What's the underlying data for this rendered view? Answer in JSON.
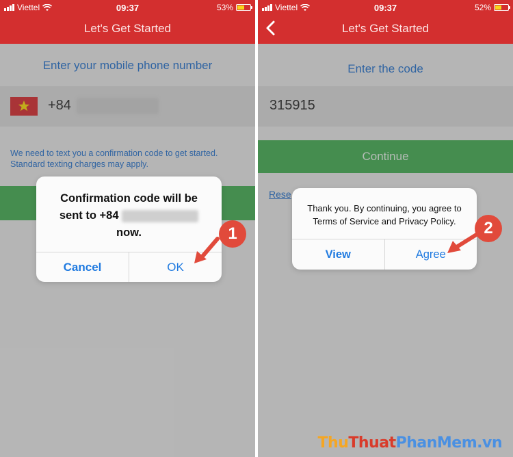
{
  "colors": {
    "topbar": "#d32f2f",
    "link_blue": "#1f6fce",
    "button_green": "#3fae4f",
    "badge_red": "#e14a3b"
  },
  "left_screen": {
    "status": {
      "carrier": "Viettel",
      "time": "09:37",
      "battery": "53%",
      "battery_level": 0.53
    },
    "nav_title": "Let's Get Started",
    "section_label": "Enter your mobile phone number",
    "country_prefix": "+84",
    "info_text": "We need to text you a confirmation code to get started. Standard texting charges may apply.",
    "dialog": {
      "line1": "Confirmation code will be",
      "line2_prefix": "sent to +84",
      "line3": "now.",
      "cancel_label": "Cancel",
      "ok_label": "OK"
    },
    "step_badge": "1"
  },
  "right_screen": {
    "status": {
      "carrier": "Viettel",
      "time": "09:37",
      "battery": "52%",
      "battery_level": 0.52
    },
    "nav_title": "Let's Get Started",
    "section_label": "Enter the code",
    "code_value": "315915",
    "continue_label": "Continue",
    "resend_label": "Rese",
    "dialog": {
      "line1": "Thank you. By continuing, you agree to",
      "line2": "Terms of Service and Privacy Policy.",
      "view_label": "View",
      "agree_label": "Agree"
    },
    "step_badge": "2"
  },
  "watermark": {
    "part1": "Thu",
    "part2": "Thuat",
    "part3": "PhanMem",
    "part4": ".vn"
  }
}
